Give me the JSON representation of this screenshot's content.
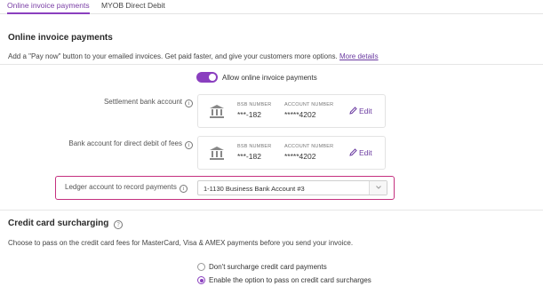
{
  "tabs": [
    {
      "label": "Online invoice payments",
      "active": true
    },
    {
      "label": "MYOB Direct Debit",
      "active": false
    }
  ],
  "online": {
    "title": "Online invoice payments",
    "description": "Add a \"Pay now\" button to your emailed invoices. Get paid faster, and give your customers more options.",
    "more_link": "More details",
    "toggle_label": "Allow online invoice payments",
    "toggle_on": true
  },
  "settlement": {
    "label": "Settlement bank account",
    "bsb_head": "BSB NUMBER",
    "bsb": "***-182",
    "acct_head": "ACCOUNT NUMBER",
    "acct": "*****4202",
    "edit": "Edit"
  },
  "fees": {
    "label": "Bank account for direct debit of fees",
    "bsb_head": "BSB NUMBER",
    "bsb": "***-182",
    "acct_head": "ACCOUNT NUMBER",
    "acct": "*****4202",
    "edit": "Edit"
  },
  "ledger": {
    "label": "Ledger account to record payments",
    "selected": "1-1130  Business Bank Account #3"
  },
  "surcharge": {
    "title": "Credit card surcharging",
    "description": "Choose to pass on the credit card fees for MasterCard, Visa & AMEX payments before you send your invoice.",
    "options": [
      {
        "label": "Don't surcharge credit card payments",
        "checked": false
      },
      {
        "label": "Enable the option to pass on credit card surcharges",
        "checked": true
      }
    ]
  },
  "colors": {
    "accent": "#8a3fbf",
    "highlight": "#c4307f"
  },
  "icons": [
    "bank-icon",
    "pencil-icon",
    "info-icon",
    "chevron-down-icon",
    "help-icon"
  ]
}
